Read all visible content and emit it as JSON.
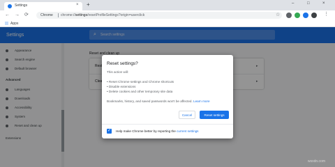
{
  "browser": {
    "tab_title": "Settings",
    "tab_close": "×",
    "new_tab": "+",
    "window_controls": [
      "–",
      "□",
      "×"
    ],
    "back": "←",
    "forward": "→",
    "reload": "⟳",
    "chip_label": "Chrome",
    "url_host": "chrome://",
    "url_bold": "settings",
    "url_rest": "/resetProfileSettings?origin=userclick",
    "star": "☆",
    "menu": "⋮",
    "bookmark_apps": "Apps",
    "ext_colors": [
      "#5f6368",
      "#34a853",
      "#1a73e8"
    ]
  },
  "settings": {
    "title": "Settings",
    "search_placeholder": "Search settings",
    "sidebar": [
      "Appearance",
      "Search engine",
      "Default browser",
      "Advanced",
      "Languages",
      "Downloads",
      "Accessibility",
      "System",
      "Reset and clean up",
      "Extensions"
    ],
    "section_title": "Reset and clean up",
    "card_rows": [
      "Rest",
      "Clea"
    ],
    "accent": "#1a73e8"
  },
  "dialog": {
    "title": "Reset settings?",
    "intro": "This action will:",
    "bullets": [
      "• Reset Chrome settings and Chrome shortcuts",
      "• Disable extensions",
      "• Delete cookies and other temporary site data"
    ],
    "note": "Bookmarks, history, and saved passwords won't be affected.",
    "learn_more": "Learn more",
    "cancel": "Cancel",
    "reset": "Reset settings",
    "checkbox_checked": true,
    "footer_text": "Help make Chrome better by reporting the",
    "footer_link": "current settings"
  },
  "watermark": "wsxdn.com"
}
